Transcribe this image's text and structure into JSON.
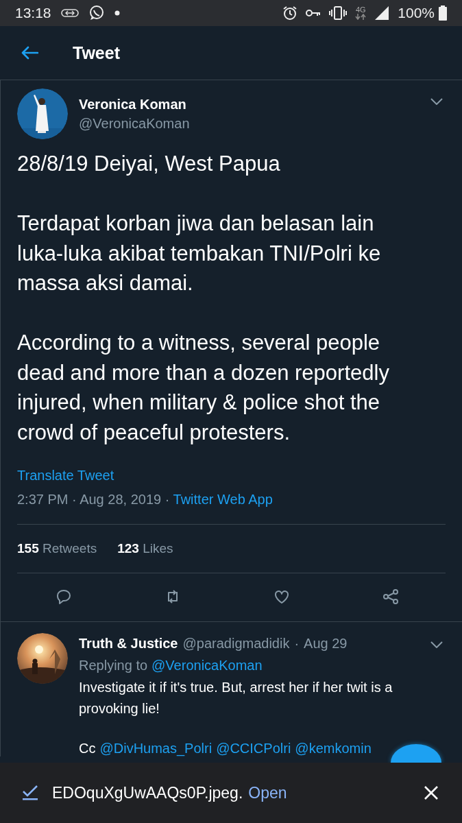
{
  "status_bar": {
    "time": "13:18",
    "network": "4G",
    "battery": "100%"
  },
  "header": {
    "title": "Tweet"
  },
  "tweet": {
    "name": "Veronica Koman",
    "handle": "@VeronicaKoman",
    "paragraphs": [
      "28/8/19 Deiyai, West Papua",
      "Terdapat korban jiwa dan belasan lain luka-luka akibat tembakan TNI/Polri ke massa aksi damai.",
      "According to a witness, several people dead and more than a dozen reportedly injured, when military & police shot the crowd of peaceful protesters."
    ],
    "translate": "Translate Tweet",
    "timestamp": "2:37 PM · Aug 28, 2019 · ",
    "source": "Twitter Web App",
    "stats": [
      {
        "count": "155",
        "label": "Retweets"
      },
      {
        "count": "123",
        "label": "Likes"
      }
    ],
    "actions": [
      {
        "kind": "reply"
      },
      {
        "kind": "retweet"
      },
      {
        "kind": "like"
      },
      {
        "kind": "share"
      }
    ]
  },
  "reply": {
    "name": "Truth & Justice",
    "handle": "@paradigmadidik",
    "separator": "·",
    "date": "Aug 29",
    "replying_to": "Replying to",
    "replying_handle": "@VeronicaKoman",
    "text": "Investigate it if it's true. But, arrest her if her twit is a provoking lie!",
    "cc": "Cc",
    "mentions": [
      "@DivHumas_Polri",
      "@CCICPolri",
      "@kemkomin"
    ]
  },
  "download_bar": {
    "filename": "EDOquXgUwAAQs0P.jpeg.",
    "action": "Open"
  }
}
